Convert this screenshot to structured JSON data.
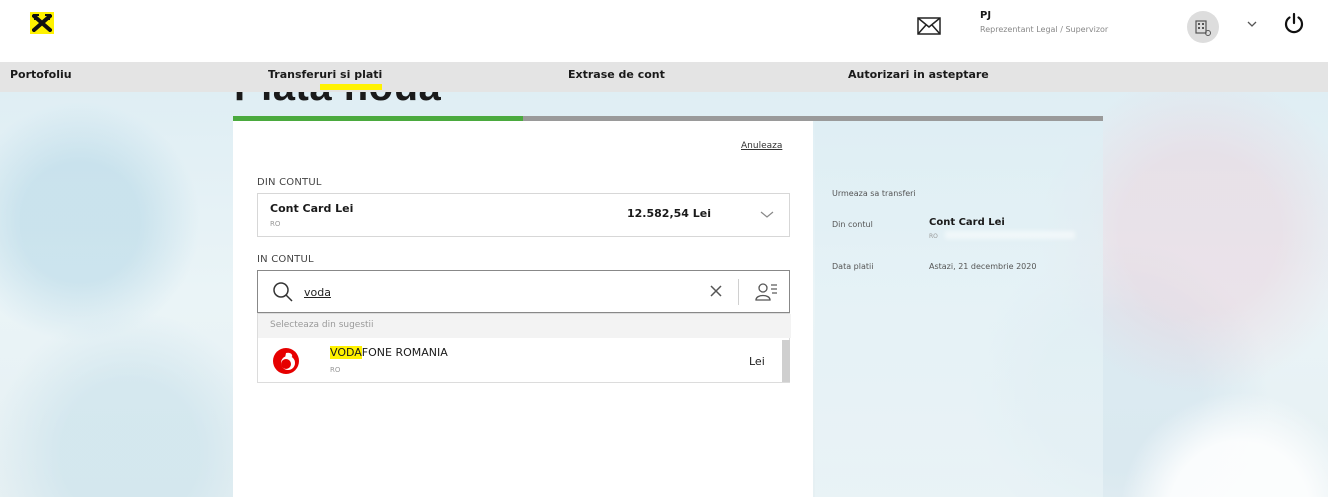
{
  "header": {
    "user_name": "PJ",
    "user_role": "Reprezentant Legal / Supervizor"
  },
  "nav": {
    "items": [
      "Portofoliu",
      "Transferuri si plati",
      "Extrase de cont",
      "Autorizari in asteptare"
    ],
    "active": "Transferuri si plati"
  },
  "page": {
    "title": "Plata noua",
    "progress_fraction": 0.333,
    "cancel_label": "Anuleaza"
  },
  "form": {
    "from_label": "DIN CONTUL",
    "from_account": {
      "name": "Cont Card Lei",
      "iban": "RO",
      "balance": "12.582,54 Lei"
    },
    "to_label": "IN CONTUL",
    "search": {
      "value": "voda"
    },
    "suggestions": {
      "header": "Selecteaza din sugestii",
      "items": [
        {
          "name_match": "VODA",
          "name_rest": "FONE ROMANIA",
          "iban": "RO",
          "currency": "Lei"
        }
      ]
    }
  },
  "summary": {
    "title": "Urmeaza sa transferi",
    "from_label": "Din contul",
    "from_account_name": "Cont Card Lei",
    "from_account_iban": "RO",
    "date_label": "Data platii",
    "date_value": "Astazi, 21 decembrie 2020"
  },
  "colors": {
    "brand_yellow": "#fff200",
    "progress_green": "#4aaa3e",
    "vodafone_red": "#e60000"
  },
  "icons": [
    "raiffeisen-logo",
    "mail-icon",
    "company-icon",
    "chevron-down-icon",
    "power-icon",
    "search-icon",
    "clear-icon",
    "contacts-icon",
    "vodafone-logo"
  ]
}
